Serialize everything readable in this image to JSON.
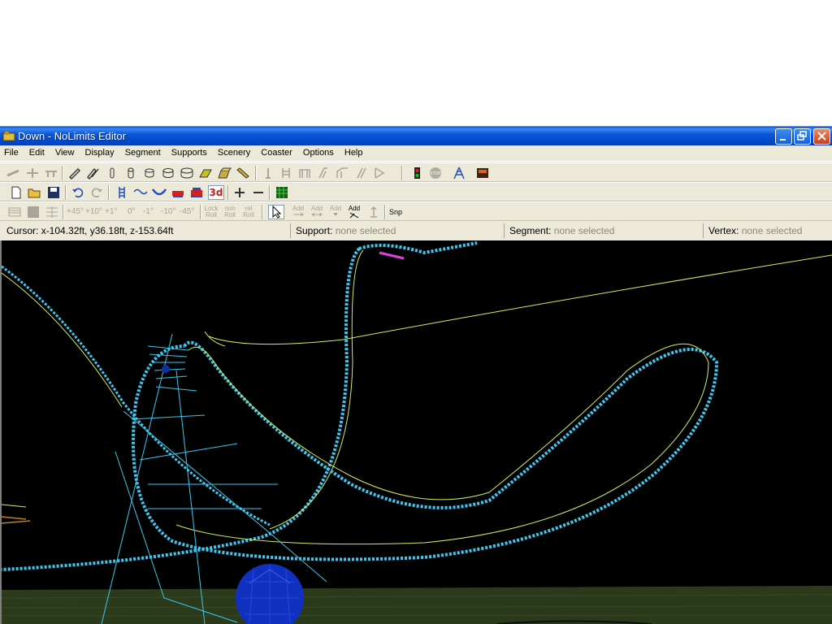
{
  "window": {
    "title": "Down - NoLimits Editor"
  },
  "menu": [
    "File",
    "Edit",
    "View",
    "Display",
    "Segment",
    "Supports",
    "Scenery",
    "Coaster",
    "Options",
    "Help"
  ],
  "toolbar": {
    "rot_labels": [
      "+45°",
      "+10°",
      "+1°",
      "0°",
      "-1°",
      "-10°",
      "-45°"
    ],
    "roll_labels": [
      "Lock",
      "Roll",
      "non",
      "Roll",
      "rel",
      "Roll"
    ],
    "add_labels": [
      "Add",
      "Add",
      "Add",
      "Add"
    ],
    "snap_label": "Snp",
    "view3d_label": "3d"
  },
  "status": {
    "cursor_key": "Cursor:",
    "cursor_val": "x-104.32ft, y36.18ft, z-153.64ft",
    "support_key": "Support:",
    "support_val": "none selected",
    "segment_key": "Segment:",
    "segment_val": "none selected",
    "vertex_key": "Vertex:",
    "vertex_val": "none selected"
  },
  "colors": {
    "track": "#3cc8f0",
    "rail": "#d0f060",
    "selection": "#e040e0",
    "ground": "#2a3a1a",
    "sphere": "#1030c0"
  }
}
